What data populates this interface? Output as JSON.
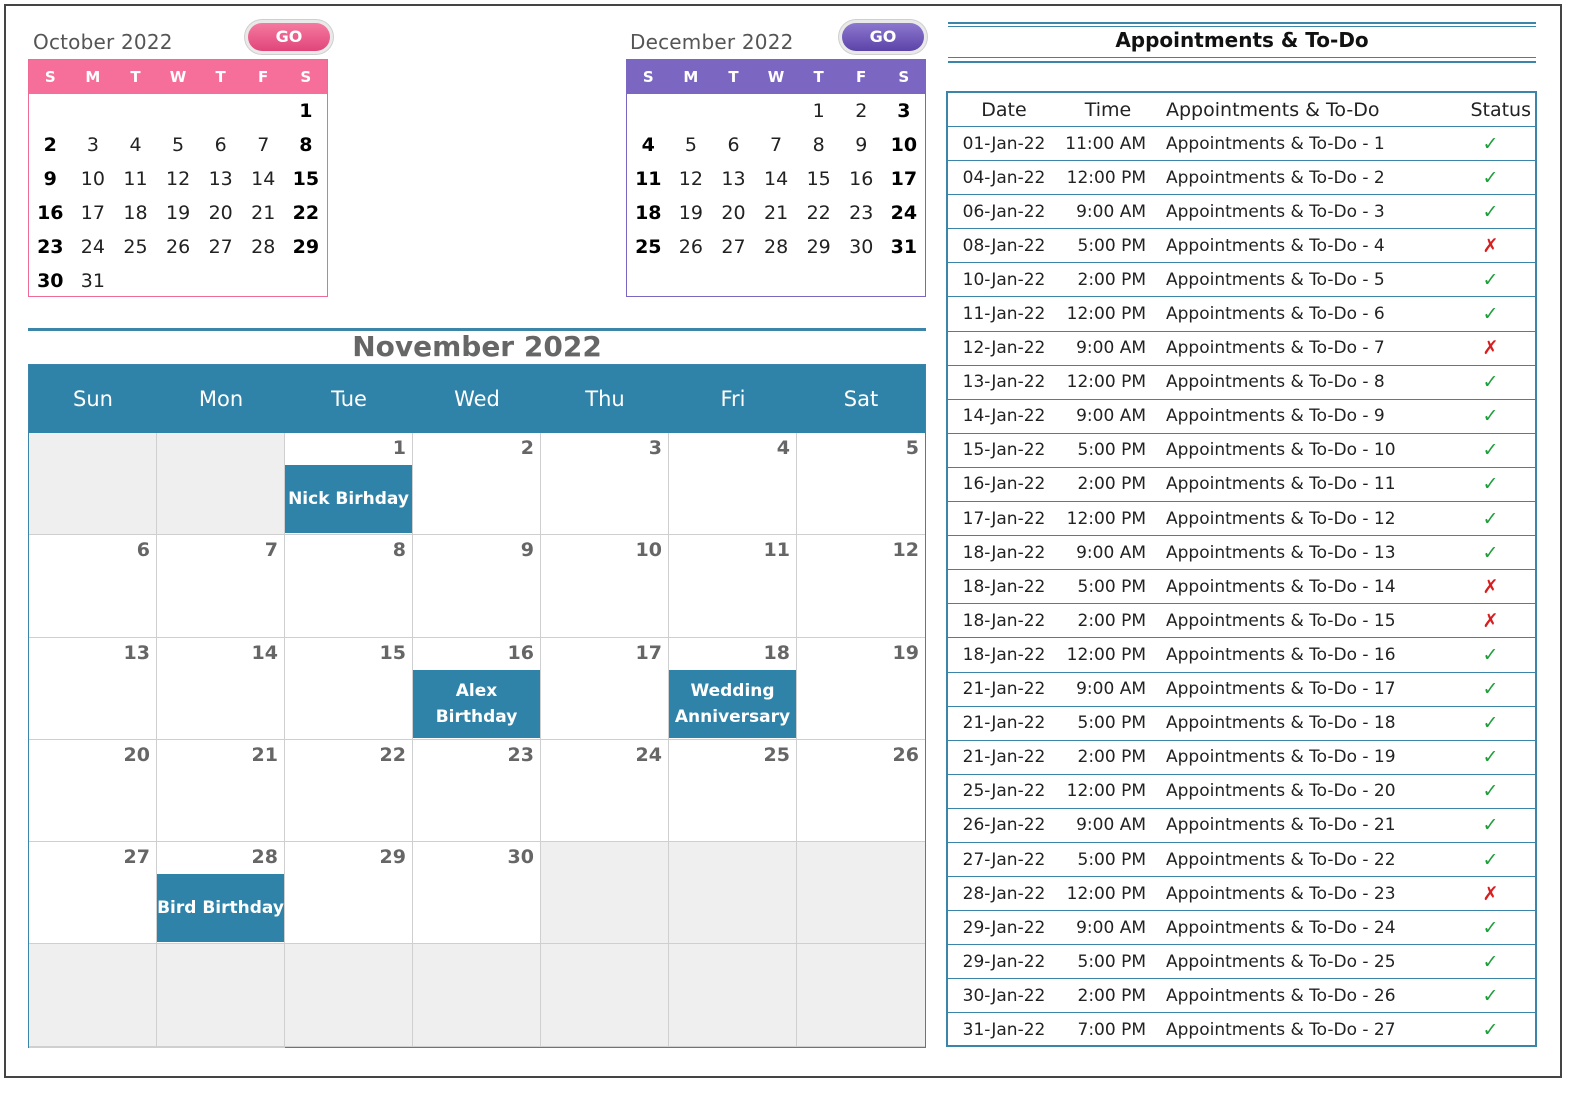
{
  "mini_calendars": [
    {
      "title": "October 2022",
      "go_label": "GO",
      "accent": "#f06a96",
      "weekdays": [
        "S",
        "M",
        "T",
        "W",
        "T",
        "F",
        "S"
      ],
      "days": [
        "",
        "",
        "",
        "",
        "",
        "",
        "1",
        "2",
        "3",
        "4",
        "5",
        "6",
        "7",
        "8",
        "9",
        "10",
        "11",
        "12",
        "13",
        "14",
        "15",
        "16",
        "17",
        "18",
        "19",
        "20",
        "21",
        "22",
        "23",
        "24",
        "25",
        "26",
        "27",
        "28",
        "29",
        "30",
        "31"
      ]
    },
    {
      "title": "December 2022",
      "go_label": "GO",
      "accent": "#7b66c2",
      "weekdays": [
        "S",
        "M",
        "T",
        "W",
        "T",
        "F",
        "S"
      ],
      "days": [
        "",
        "",
        "",
        "",
        "1",
        "2",
        "3",
        "4",
        "5",
        "6",
        "7",
        "8",
        "9",
        "10",
        "11",
        "12",
        "13",
        "14",
        "15",
        "16",
        "17",
        "18",
        "19",
        "20",
        "21",
        "22",
        "23",
        "24",
        "25",
        "26",
        "27",
        "28",
        "29",
        "30",
        "31"
      ]
    }
  ],
  "month": {
    "title": "November 2022",
    "accent": "#3083a8",
    "weekdays": [
      "Sun",
      "Mon",
      "Tue",
      "Wed",
      "Thu",
      "Fri",
      "Sat"
    ],
    "days": [
      "",
      "",
      "1",
      "2",
      "3",
      "4",
      "5",
      "6",
      "7",
      "8",
      "9",
      "10",
      "11",
      "12",
      "13",
      "14",
      "15",
      "16",
      "17",
      "18",
      "19",
      "20",
      "21",
      "22",
      "23",
      "24",
      "25",
      "26",
      "27",
      "28",
      "29",
      "30",
      "",
      "",
      "",
      "",
      "",
      "",
      "",
      "",
      "",
      "",
      "",
      ""
    ],
    "events": {
      "1": "Nick Birhday",
      "16": "Alex Birthday",
      "18": "Wedding Anniversary",
      "28": "Bird Birthday"
    }
  },
  "appointments": {
    "title": "Appointments  & To-Do",
    "headers": {
      "date": "Date",
      "time": "Time",
      "task": "Appointments  & To-Do",
      "status": "Status"
    },
    "status_colors": {
      "done": "#1e9e3a",
      "missed": "#d81e1e"
    },
    "rows": [
      {
        "date": "01-Jan-22",
        "time": "11:00 AM",
        "task": "Appointments  & To-Do - 1",
        "status": "✓"
      },
      {
        "date": "04-Jan-22",
        "time": "12:00 PM",
        "task": "Appointments  & To-Do - 2",
        "status": "✓"
      },
      {
        "date": "06-Jan-22",
        "time": "9:00 AM",
        "task": "Appointments  & To-Do - 3",
        "status": "✓"
      },
      {
        "date": "08-Jan-22",
        "time": "5:00 PM",
        "task": "Appointments  & To-Do - 4",
        "status": "✗"
      },
      {
        "date": "10-Jan-22",
        "time": "2:00 PM",
        "task": "Appointments  & To-Do - 5",
        "status": "✓"
      },
      {
        "date": "11-Jan-22",
        "time": "12:00 PM",
        "task": "Appointments  & To-Do - 6",
        "status": "✓"
      },
      {
        "date": "12-Jan-22",
        "time": "9:00 AM",
        "task": "Appointments  & To-Do - 7",
        "status": "✗"
      },
      {
        "date": "13-Jan-22",
        "time": "12:00 PM",
        "task": "Appointments  & To-Do - 8",
        "status": "✓"
      },
      {
        "date": "14-Jan-22",
        "time": "9:00 AM",
        "task": "Appointments  & To-Do - 9",
        "status": "✓"
      },
      {
        "date": "15-Jan-22",
        "time": "5:00 PM",
        "task": "Appointments  & To-Do - 10",
        "status": "✓"
      },
      {
        "date": "16-Jan-22",
        "time": "2:00 PM",
        "task": "Appointments  & To-Do - 11",
        "status": "✓"
      },
      {
        "date": "17-Jan-22",
        "time": "12:00 PM",
        "task": "Appointments  & To-Do - 12",
        "status": "✓"
      },
      {
        "date": "18-Jan-22",
        "time": "9:00 AM",
        "task": "Appointments  & To-Do - 13",
        "status": "✓"
      },
      {
        "date": "18-Jan-22",
        "time": "5:00 PM",
        "task": "Appointments  & To-Do - 14",
        "status": "✗"
      },
      {
        "date": "18-Jan-22",
        "time": "2:00 PM",
        "task": "Appointments  & To-Do - 15",
        "status": "✗"
      },
      {
        "date": "18-Jan-22",
        "time": "12:00 PM",
        "task": "Appointments  & To-Do - 16",
        "status": "✓"
      },
      {
        "date": "21-Jan-22",
        "time": "9:00 AM",
        "task": "Appointments  & To-Do - 17",
        "status": "✓"
      },
      {
        "date": "21-Jan-22",
        "time": "5:00 PM",
        "task": "Appointments  & To-Do - 18",
        "status": "✓"
      },
      {
        "date": "21-Jan-22",
        "time": "2:00 PM",
        "task": "Appointments  & To-Do - 19",
        "status": "✓"
      },
      {
        "date": "25-Jan-22",
        "time": "12:00 PM",
        "task": "Appointments  & To-Do - 20",
        "status": "✓"
      },
      {
        "date": "26-Jan-22",
        "time": "9:00 AM",
        "task": "Appointments  & To-Do - 21",
        "status": "✓"
      },
      {
        "date": "27-Jan-22",
        "time": "5:00 PM",
        "task": "Appointments  & To-Do - 22",
        "status": "✓"
      },
      {
        "date": "28-Jan-22",
        "time": "12:00 PM",
        "task": "Appointments  & To-Do - 23",
        "status": "✗"
      },
      {
        "date": "29-Jan-22",
        "time": "9:00 AM",
        "task": "Appointments  & To-Do - 24",
        "status": "✓"
      },
      {
        "date": "29-Jan-22",
        "time": "5:00 PM",
        "task": "Appointments  & To-Do - 25",
        "status": "✓"
      },
      {
        "date": "30-Jan-22",
        "time": "2:00 PM",
        "task": "Appointments  & To-Do - 26",
        "status": "✓"
      },
      {
        "date": "31-Jan-22",
        "time": "7:00 PM",
        "task": "Appointments  & To-Do - 27",
        "status": "✓"
      }
    ]
  }
}
